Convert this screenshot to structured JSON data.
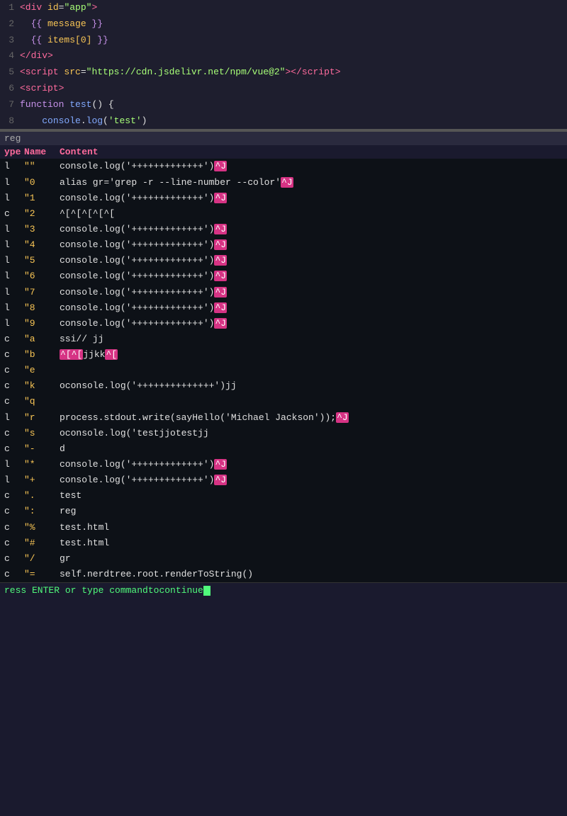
{
  "editor": {
    "lines": [
      {
        "num": "1",
        "tokens": [
          {
            "type": "tag",
            "text": "<div"
          },
          {
            "type": "plain",
            "text": " "
          },
          {
            "type": "attr",
            "text": "id"
          },
          {
            "type": "plain",
            "text": "="
          },
          {
            "type": "string",
            "text": "\"app\""
          },
          {
            "type": "tag",
            "text": ">"
          }
        ]
      },
      {
        "num": "2",
        "tokens": [
          {
            "type": "plain",
            "text": "  "
          },
          {
            "type": "mustache",
            "text": "{{ "
          },
          {
            "type": "mustache-var",
            "text": "message"
          },
          {
            "type": "mustache",
            "text": " }}"
          }
        ]
      },
      {
        "num": "3",
        "tokens": [
          {
            "type": "plain",
            "text": "  "
          },
          {
            "type": "mustache",
            "text": "{{ "
          },
          {
            "type": "mustache-var",
            "text": "items[0]"
          },
          {
            "type": "mustache",
            "text": " }}"
          }
        ]
      },
      {
        "num": "4",
        "tokens": [
          {
            "type": "tag",
            "text": "</div>"
          }
        ]
      },
      {
        "num": "5",
        "tokens": [
          {
            "type": "tag",
            "text": "<script"
          },
          {
            "type": "plain",
            "text": " "
          },
          {
            "type": "attr",
            "text": "src"
          },
          {
            "type": "plain",
            "text": "="
          },
          {
            "type": "string",
            "text": "\"https://cdn.jsdelivr.net/npm/vue@2\""
          },
          {
            "type": "tag",
            "text": "></"
          },
          {
            "type": "tag",
            "text": "script>"
          }
        ]
      },
      {
        "num": "6",
        "tokens": [
          {
            "type": "tag",
            "text": "<script>"
          }
        ]
      },
      {
        "num": "7",
        "tokens": [
          {
            "type": "keyword",
            "text": "function"
          },
          {
            "type": "plain",
            "text": " "
          },
          {
            "type": "func",
            "text": "test"
          },
          {
            "type": "plain",
            "text": "() {"
          }
        ]
      },
      {
        "num": "8",
        "tokens": [
          {
            "type": "plain",
            "text": "    "
          },
          {
            "type": "func",
            "text": "console"
          },
          {
            "type": "plain",
            "text": "."
          },
          {
            "type": "func",
            "text": "log"
          },
          {
            "type": "plain",
            "text": "("
          },
          {
            "type": "string",
            "text": "'test'"
          },
          {
            "type": "plain",
            "text": ")"
          }
        ]
      }
    ]
  },
  "reg_header": "reg",
  "reg_cols": {
    "type": "ype",
    "name": "Name",
    "content": "Content"
  },
  "reg_rows": [
    {
      "type": "l",
      "name": "\"\"",
      "content": "console.log('+++++++++++++')",
      "highlight_content": true,
      "highlight_end": true
    },
    {
      "type": "l",
      "name": "\"0",
      "content": "alias gr='grep -r --line-number --color'",
      "highlight_content": false,
      "highlight_end": true
    },
    {
      "type": "l",
      "name": "\"1",
      "content": "console.log('+++++++++++++')",
      "highlight_content": true,
      "highlight_end": true
    },
    {
      "type": "c",
      "name": "\"2",
      "content": "^[^[^[^[^[",
      "highlight_content": true,
      "highlight_end": false
    },
    {
      "type": "l",
      "name": "\"3",
      "content": "console.log('+++++++++++++')",
      "highlight_content": true,
      "highlight_end": true
    },
    {
      "type": "l",
      "name": "\"4",
      "content": "console.log('+++++++++++++')",
      "highlight_content": true,
      "highlight_end": true
    },
    {
      "type": "l",
      "name": "\"5",
      "content": "console.log('+++++++++++++')",
      "highlight_content": true,
      "highlight_end": true
    },
    {
      "type": "l",
      "name": "\"6",
      "content": "console.log('+++++++++++++')",
      "highlight_content": true,
      "highlight_end": true
    },
    {
      "type": "l",
      "name": "\"7",
      "content": "console.log('+++++++++++++')",
      "highlight_content": true,
      "highlight_end": true
    },
    {
      "type": "l",
      "name": "\"8",
      "content": "console.log('+++++++++++++')",
      "highlight_content": true,
      "highlight_end": true
    },
    {
      "type": "l",
      "name": "\"9",
      "content": "console.log('+++++++++++++')",
      "highlight_content": true,
      "highlight_end": true
    },
    {
      "type": "c",
      "name": "\"a",
      "content": "ssi// jj",
      "highlight_content": false,
      "highlight_end": false
    },
    {
      "type": "c",
      "name": "\"b",
      "content_parts": [
        "^[^[",
        "jjkk",
        "^["
      ],
      "highlight_content": true,
      "highlight_end": false
    },
    {
      "type": "c",
      "name": "\"e",
      "content": "",
      "highlight_content": false,
      "highlight_end": false
    },
    {
      "type": "c",
      "name": "\"k",
      "content": "oconsole.log('++++++++++++++')",
      "highlight_content": false,
      "highlight_end": false,
      "suffix": "jj"
    },
    {
      "type": "c",
      "name": "\"q",
      "content": "",
      "highlight_content": false,
      "highlight_end": false
    },
    {
      "type": "l",
      "name": "\"r",
      "content": "process.stdout.write(sayHello('Michael Jackson'));",
      "highlight_content": false,
      "highlight_end": true
    },
    {
      "type": "c",
      "name": "\"s",
      "content": "oconsole.log('testjjotestjj",
      "highlight_content": false,
      "highlight_end": false
    },
    {
      "type": "c",
      "name": "\"-",
      "content": "d",
      "highlight_content": false,
      "highlight_end": false
    },
    {
      "type": "l",
      "name": "\"*",
      "content": "console.log('+++++++++++++')",
      "highlight_content": true,
      "highlight_end": true
    },
    {
      "type": "l",
      "name": "\"+",
      "content": "console.log('+++++++++++++')",
      "highlight_content": true,
      "highlight_end": true
    },
    {
      "type": "c",
      "name": "\".",
      "content": "test",
      "highlight_content": false,
      "highlight_end": false
    },
    {
      "type": "c",
      "name": "\":",
      "content": "reg",
      "highlight_content": false,
      "highlight_end": false
    },
    {
      "type": "c",
      "name": "\"%",
      "content": "test.html",
      "highlight_content": false,
      "highlight_end": false
    },
    {
      "type": "c",
      "name": "\"#",
      "content": "test.html",
      "highlight_content": false,
      "highlight_end": false
    },
    {
      "type": "c",
      "name": "\"/",
      "content": "gr",
      "highlight_content": false,
      "highlight_end": false
    },
    {
      "type": "c",
      "name": "\"=",
      "content": "self.nerdtree.root.renderToString()",
      "highlight_content": false,
      "highlight_end": false
    }
  ],
  "status_bar": {
    "text": "ress ENTER or type command to continue"
  }
}
